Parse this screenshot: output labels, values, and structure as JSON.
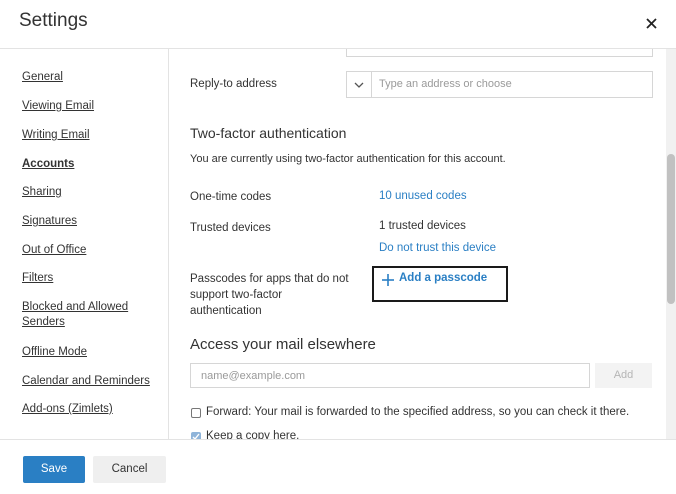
{
  "header": {
    "title": "Settings"
  },
  "sidebar": {
    "items": [
      {
        "label": "General"
      },
      {
        "label": "Viewing Email"
      },
      {
        "label": "Writing Email"
      },
      {
        "label": "Accounts"
      },
      {
        "label": "Sharing"
      },
      {
        "label": "Signatures"
      },
      {
        "label": "Out of Office"
      },
      {
        "label": "Filters"
      },
      {
        "label": "Blocked and Allowed Senders"
      },
      {
        "label": "Offline Mode"
      },
      {
        "label": "Calendar and Reminders"
      },
      {
        "label": "Add-ons (Zimlets)"
      }
    ],
    "active_item": "Accounts"
  },
  "reply_to": {
    "label": "Reply-to address",
    "placeholder": "Type an address or choose"
  },
  "two_factor": {
    "title": "Two-factor authentication",
    "description": "You are currently using two-factor authentication for this account.",
    "one_time_codes_label": "One-time codes",
    "one_time_codes_value": "10 unused codes",
    "trusted_devices_label": "Trusted devices",
    "trusted_devices_value": "1 trusted devices",
    "do_not_trust_link": "Do not trust this device",
    "passcodes_label_1": "Passcodes for apps that do not",
    "passcodes_label_2": "support two-factor",
    "passcodes_label_3": "authentication",
    "add_passcode": "Add a passcode"
  },
  "access_elsewhere": {
    "title": "Access your mail elsewhere",
    "email_placeholder": "name@example.com",
    "add_button": "Add",
    "forward_label": "Forward: Your mail is forwarded to the specified address, so you can check it there.",
    "keep_copy_label": "Keep a copy here."
  },
  "footer": {
    "save": "Save",
    "cancel": "Cancel"
  },
  "colors": {
    "accent": "#2a7fc4",
    "link": "#2a7fc4"
  }
}
